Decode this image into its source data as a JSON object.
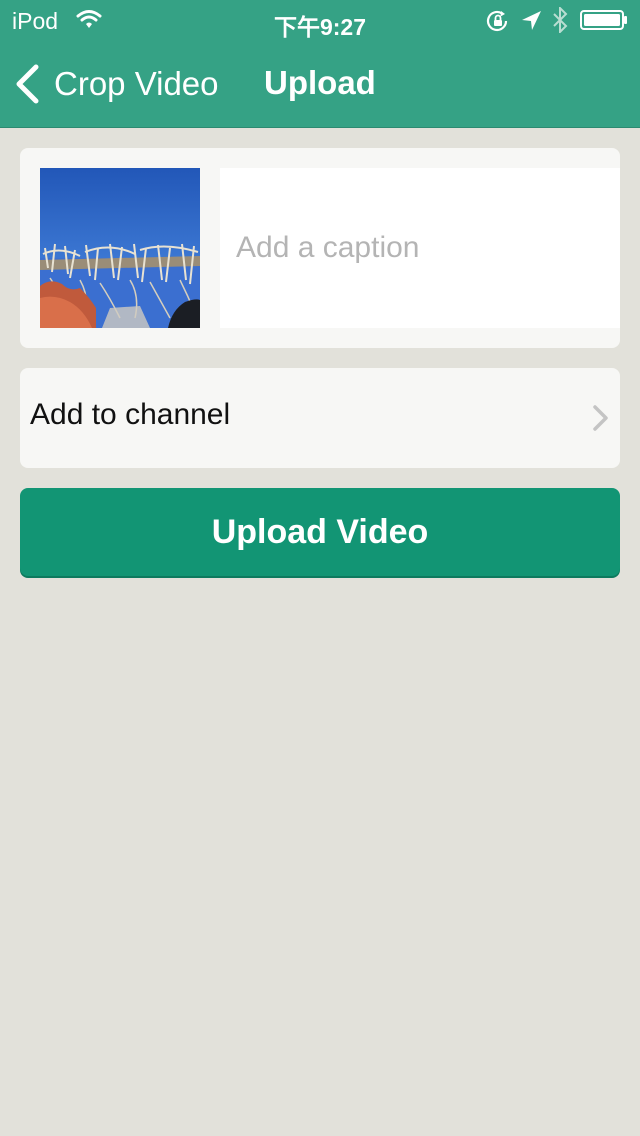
{
  "status_bar": {
    "carrier": "iPod",
    "time": "下午9:27",
    "icons": [
      "wifi-icon",
      "rotation-lock-icon",
      "location-arrow-icon",
      "bluetooth-icon",
      "battery-icon"
    ]
  },
  "nav": {
    "back_label": "Crop Video",
    "title": "Upload"
  },
  "caption": {
    "placeholder": "Add a caption",
    "value": ""
  },
  "channel": {
    "label": "Add to channel"
  },
  "upload_button": {
    "label": "Upload Video"
  },
  "colors": {
    "header": "#35a285",
    "button": "#129574",
    "background": "#e2e1da",
    "card": "#f7f7f5",
    "placeholder": "#b4b4b4"
  }
}
